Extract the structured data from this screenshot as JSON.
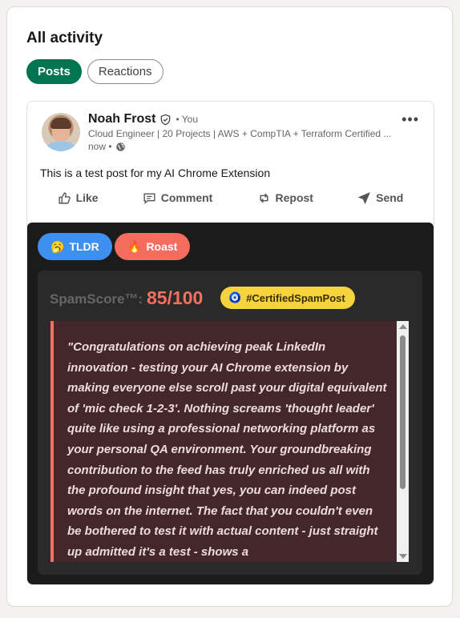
{
  "section": {
    "title": "All activity"
  },
  "tabs": [
    {
      "label": "Posts",
      "active": true
    },
    {
      "label": "Reactions",
      "active": false
    }
  ],
  "post": {
    "author": "Noah Frost",
    "you_label": "• You",
    "headline": "Cloud Engineer | 20 Projects | AWS + CompTIA + Terraform Certified ...",
    "time": "now •",
    "text": "This is a test post for my AI Chrome Extension",
    "actions": [
      "Like",
      "Comment",
      "Repost",
      "Send"
    ]
  },
  "extension": {
    "tldr_label": "TLDR",
    "tldr_emoji": "🥱",
    "roast_label": "Roast",
    "roast_emoji": "🔥",
    "score_label": "SpamScore™:",
    "score_value": "85/100",
    "badge_label": "#CertifiedSpamPost",
    "badge_emoji": "🧿",
    "roast_text": "\"Congratulations on achieving peak LinkedIn innovation - testing your AI Chrome extension by making everyone else scroll past your digital equivalent of 'mic check 1-2-3'. Nothing screams 'thought leader' quite like using a professional networking platform as your personal QA environment. Your groundbreaking contribution to the feed has truly enriched us all with the profound insight that yes, you can indeed post words on the internet. The fact that you couldn't even be bothered to test it with actual content - just straight up admitted it's a test - shows a",
    "colors": {
      "tldr": "#3d8ff0",
      "roast": "#f46c5e",
      "score": "#f4705f",
      "badge": "#f5d33d"
    }
  }
}
